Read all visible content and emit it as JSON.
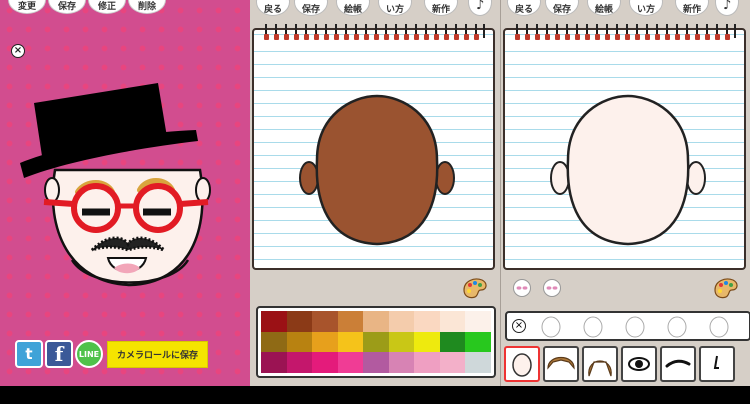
{
  "left_panel": {
    "top_buttons": [
      "変更",
      "保存",
      "修正",
      "削除"
    ],
    "share": {
      "twitter_glyph": "t",
      "facebook_glyph": "f",
      "line_glyph": "LINE"
    },
    "save_to_camera_roll": "カメラロールに保存",
    "background_color": "#d24d8f"
  },
  "editor1": {
    "toolbar": [
      "戻る",
      "保存",
      "絵帳",
      "い方",
      "新作"
    ],
    "skin_color": "#9a5330",
    "swatch_colors": [
      "#9b1115",
      "#8b3a17",
      "#a8542c",
      "#cb7f37",
      "#e9b585",
      "#f4ccac",
      "#fad8c1",
      "#fbe6d6",
      "#fcf1ea",
      "#8f6a15",
      "#b88211",
      "#e7a01c",
      "#f5c31a",
      "#9c9c18",
      "#c9c716",
      "#eeea0e",
      "#1f8a1f",
      "#28c81e",
      "#9b1353",
      "#c4176c",
      "#e41b7b",
      "#f03c95",
      "#b25aa0",
      "#d783b4",
      "#ef9fc2",
      "#f3b0c9",
      "#cfd8da"
    ]
  },
  "editor2": {
    "toolbar": [
      "戻る",
      "保存",
      "絵帳",
      "い方",
      "新作"
    ],
    "skin_color": "#fdf1ec"
  }
}
